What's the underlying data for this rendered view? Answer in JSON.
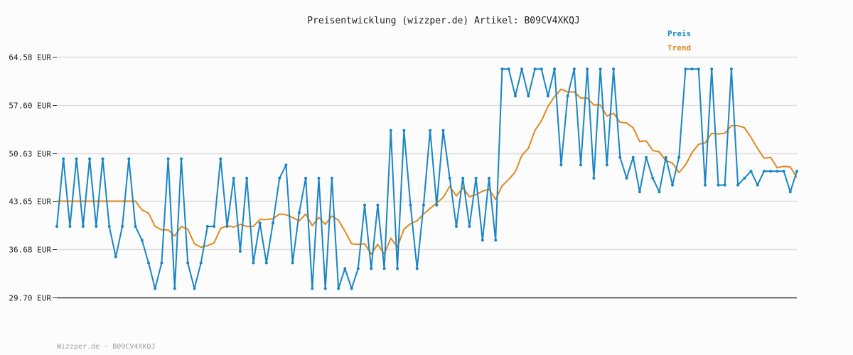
{
  "chart_data": {
    "type": "line",
    "title": "Preisentwicklung (wizzper.de) Artikel: B09CV4XKQJ",
    "footer": "Wizzper.de - B09CV4XKQJ",
    "ylim": [
      29.7,
      64.58
    ],
    "yticks": [
      "64.58 EUR",
      "57.60 EUR",
      "50.63 EUR",
      "43.65 EUR",
      "36.68 EUR",
      "29.70 EUR"
    ],
    "ytick_values": [
      64.58,
      57.6,
      50.63,
      43.65,
      36.68,
      29.7
    ],
    "grid": true,
    "legend_position": "top-right",
    "colors": {
      "preis": "#1a85c5",
      "trend": "#e0891f"
    },
    "series": [
      {
        "name": "Preis",
        "values": [
          40.0,
          49.8,
          40.0,
          49.8,
          40.0,
          49.8,
          40.0,
          49.8,
          40.0,
          35.6,
          40.0,
          49.8,
          40.0,
          38.0,
          34.7,
          31.0,
          34.7,
          49.8,
          31.0,
          49.8,
          34.7,
          31.0,
          34.7,
          40.0,
          40.0,
          49.8,
          40.0,
          47.0,
          36.4,
          47.0,
          34.7,
          40.5,
          34.7,
          40.5,
          47.0,
          48.9,
          34.7,
          42.0,
          47.0,
          31.0,
          47.0,
          31.0,
          47.0,
          31.0,
          33.9,
          31.0,
          33.9,
          43.1,
          33.9,
          43.1,
          33.9,
          53.9,
          33.9,
          53.9,
          43.1,
          33.9,
          43.1,
          53.9,
          43.1,
          53.9,
          47.0,
          40.0,
          47.0,
          40.0,
          47.0,
          38.0,
          47.0,
          38.0,
          62.8,
          62.8,
          58.9,
          62.8,
          58.9,
          62.8,
          62.8,
          58.9,
          62.8,
          48.9,
          58.9,
          62.8,
          48.9,
          62.8,
          47.0,
          62.8,
          48.9,
          62.8,
          50.0,
          47.0,
          50.0,
          45.0,
          50.0,
          47.0,
          45.0,
          50.0,
          46.0,
          50.0,
          62.8,
          62.8,
          62.8,
          46.0,
          62.8,
          46.0,
          46.0,
          62.8,
          46.0,
          47.0,
          48.0,
          46.0,
          48.0,
          48.0,
          48.0,
          48.0,
          45.0,
          48.0
        ]
      },
      {
        "name": "Trend",
        "values": [
          43.65,
          43.65,
          43.65,
          43.65,
          43.65,
          43.65,
          43.65,
          43.65,
          43.65,
          43.65,
          43.65,
          43.65,
          43.65,
          42.4,
          41.9,
          40.0,
          39.5,
          39.5,
          38.6,
          40.0,
          39.6,
          37.5,
          37.0,
          37.2,
          37.6,
          39.7,
          40.1,
          39.9,
          40.3,
          40.0,
          40.0,
          41.0,
          41.0,
          41.1,
          41.8,
          41.7,
          41.3,
          40.8,
          41.8,
          40.1,
          41.3,
          40.3,
          41.5,
          40.9,
          39.3,
          37.5,
          37.4,
          37.5,
          36.0,
          37.4,
          36.0,
          38.3,
          37.0,
          39.6,
          40.4,
          40.8,
          41.8,
          42.6,
          43.4,
          44.2,
          45.8,
          44.4,
          45.6,
          44.3,
          44.6,
          45.1,
          45.4,
          43.9,
          45.9,
          46.8,
          47.9,
          50.3,
          51.3,
          53.9,
          55.3,
          57.4,
          58.8,
          59.9,
          59.5,
          59.5,
          58.6,
          58.6,
          57.6,
          57.6,
          56.0,
          56.4,
          55.1,
          55.0,
          54.3,
          52.3,
          52.4,
          51.0,
          50.8,
          49.5,
          49.2,
          47.8,
          48.9,
          50.7,
          51.9,
          52.1,
          53.5,
          53.4,
          53.5,
          54.6,
          54.6,
          54.3,
          52.9,
          51.3,
          49.9,
          50.0,
          48.5,
          48.7,
          48.6,
          47.1
        ]
      }
    ]
  }
}
